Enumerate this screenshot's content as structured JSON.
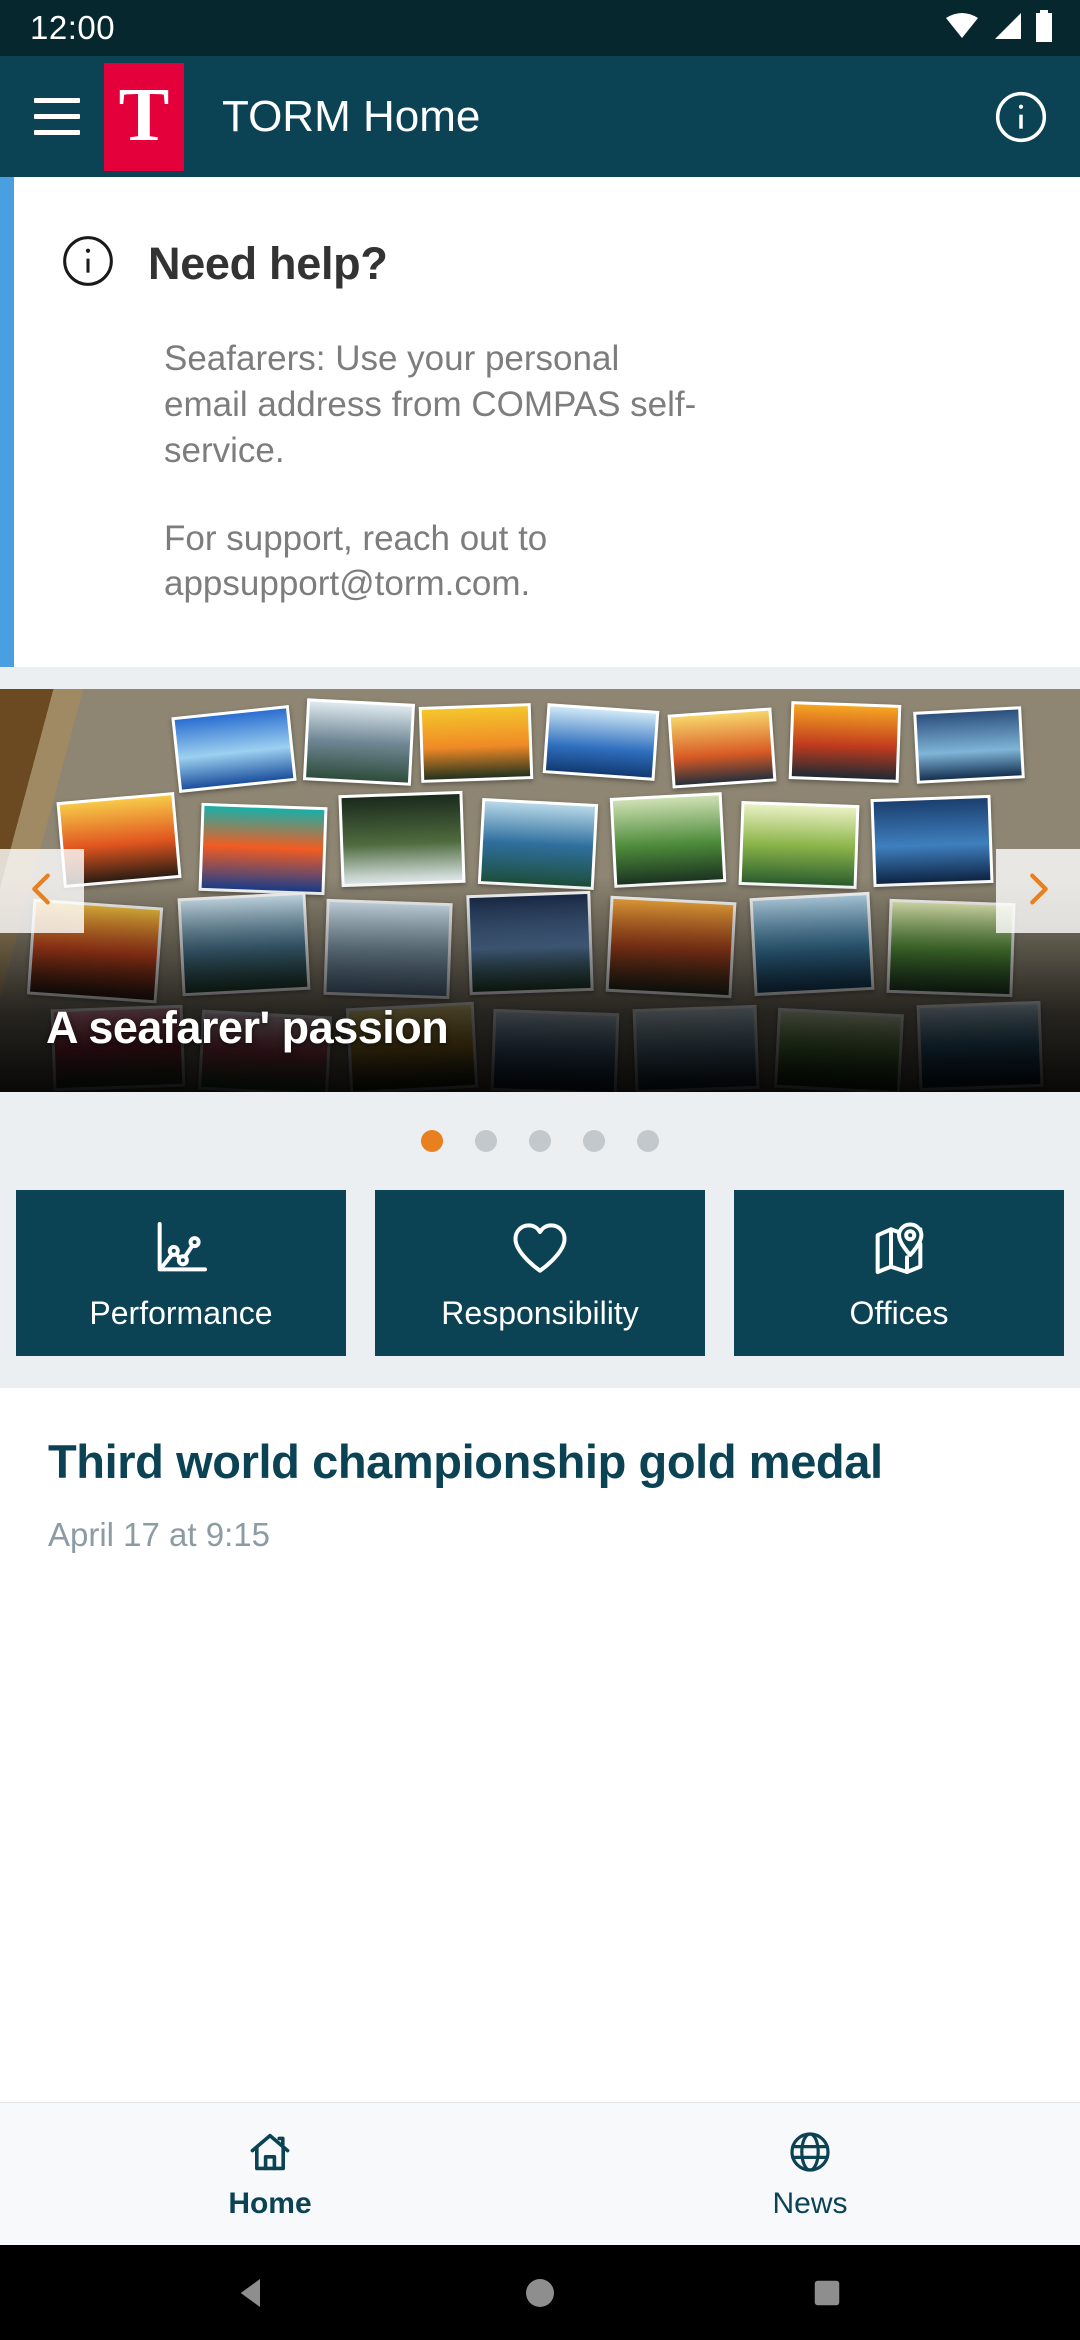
{
  "status_bar": {
    "time": "12:00",
    "icons": [
      "wifi-icon",
      "cellular-signal-icon",
      "battery-icon"
    ]
  },
  "app_bar": {
    "menu_icon": "hamburger-menu-icon",
    "logo_letter": "T",
    "logo_color": "#e4003a",
    "title": "TORM Home",
    "info_icon": "info-circle-icon",
    "background": "#0b4355"
  },
  "help_card": {
    "icon": "info-circle-icon",
    "accent_color": "#4a9fe0",
    "title": "Need help?",
    "paragraphs": [
      "Seafarers: Use your personal email address from COMPAS self-service.",
      "For support, reach out to appsupport@torm.com."
    ]
  },
  "carousel": {
    "caption": "A seafarer' passion",
    "prev_icon": "chevron-left-icon",
    "next_icon": "chevron-right-icon",
    "arrow_color": "#e8801f",
    "dots_total": 5,
    "active_dot": 1,
    "active_dot_color": "#e8801f",
    "inactive_dot_color": "#c2c8cc"
  },
  "tiles": [
    {
      "label": "Performance",
      "icon": "line-chart-icon"
    },
    {
      "label": "Responsibility",
      "icon": "heart-icon"
    },
    {
      "label": "Offices",
      "icon": "map-pin-icon"
    }
  ],
  "news": {
    "title": "Third world championship gold medal",
    "date": "April 17 at 9:15"
  },
  "bottom_nav": {
    "items": [
      {
        "label": "Home",
        "icon": "house-icon",
        "active": true
      },
      {
        "label": "News",
        "icon": "globe-icon",
        "active": false
      }
    ]
  },
  "android_nav": {
    "back": "back-triangle-icon",
    "home": "home-circle-icon",
    "recents": "recents-square-icon"
  }
}
